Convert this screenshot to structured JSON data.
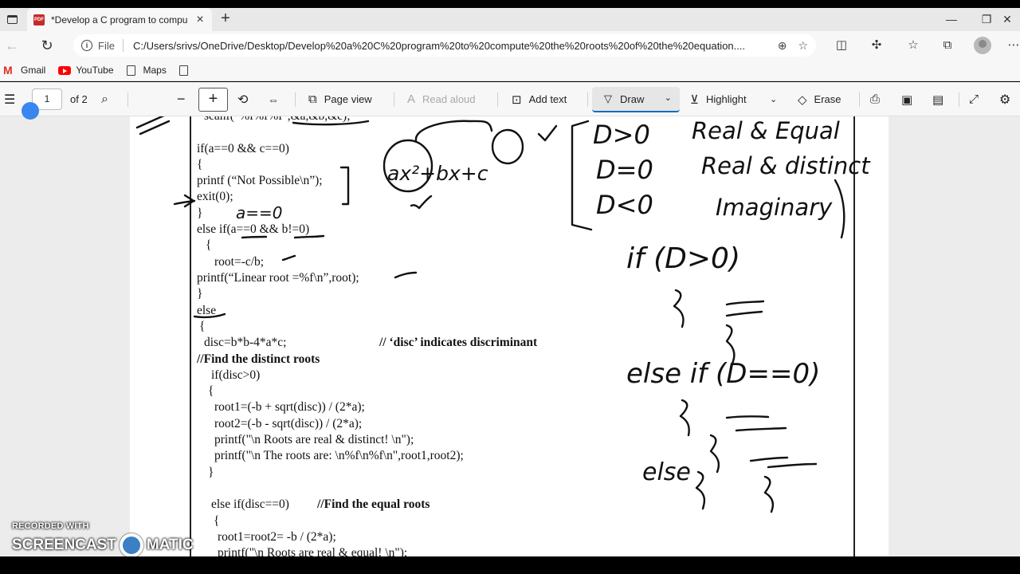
{
  "browser": {
    "tab_title": "*Develop a C program to compu",
    "url_scheme": "File",
    "url": "C:/Users/srivs/OneDrive/Desktop/Develop%20a%20C%20program%20to%20compute%20the%20roots%20of%20the%20equation....",
    "bookmarks": [
      {
        "label": "Gmail",
        "icon": "gmail-icon"
      },
      {
        "label": "YouTube",
        "icon": "youtube-icon"
      },
      {
        "label": "Maps",
        "icon": "page-icon"
      },
      {
        "label": "",
        "icon": "page-icon"
      }
    ]
  },
  "pdf_toolbar": {
    "page_number": "1",
    "page_total": "of 2",
    "page_view": "Page view",
    "read_aloud": "Read aloud",
    "add_text": "Add text",
    "draw": "Draw",
    "highlight": "Highlight",
    "erase": "Erase"
  },
  "document": {
    "lines": [
      {
        "text": "scanf(\"%f%f%f\",&a,&b,&c);"
      },
      {
        "text": "if(a==0 && c==0)"
      },
      {
        "text": "{"
      },
      {
        "text": "printf (“Not Possible\\n”);"
      },
      {
        "text": "exit(0);"
      },
      {
        "text": "}"
      },
      {
        "text": "else if(a==0 && b!=0)"
      },
      {
        "text": "{"
      },
      {
        "text": "root=-c/b;"
      },
      {
        "text": "printf(“Linear root =%f\\n”,root);"
      },
      {
        "text": "}"
      },
      {
        "text": "else"
      },
      {
        "text": "{"
      },
      {
        "text": "disc=b*b-4*a*c;"
      },
      {
        "text": "// ‘disc’ indicates discriminant"
      },
      {
        "text": "//Find the distinct roots"
      },
      {
        "text": "if(disc>0)"
      },
      {
        "text": "{"
      },
      {
        "text": "root1=(-b + sqrt(disc)) / (2*a);"
      },
      {
        "text": "root2=(-b - sqrt(disc)) / (2*a);"
      },
      {
        "text": "printf(\"\\n Roots are real & distinct! \\n\");"
      },
      {
        "text": "printf(\"\\n The roots are: \\n%f\\n%f\\n\",root1,root2);"
      },
      {
        "text": "}"
      },
      {
        "text": "else if(disc==0)"
      },
      {
        "text": "//Find the equal roots"
      },
      {
        "text": "{"
      },
      {
        "text": "root1=root2= -b / (2*a);"
      },
      {
        "text": "printf(\"\\n Roots are real & equal! \\n\");"
      }
    ]
  },
  "annotations": {
    "a_eq_0": "a==0",
    "poly": "ax²+bx+c",
    "d_gt": "D>0",
    "d_eq": "D=0",
    "d_lt": "D<0",
    "real_equal": "Real & Equal",
    "real_distinct": "Real & distinct",
    "imaginary": "Imaginary",
    "if_d": "if (D>0)",
    "else_if_d": "else if (D==0)",
    "else": "else"
  },
  "watermark": {
    "line1": "RECORDED WITH",
    "left": "SCREENCAST",
    "right": "MATIC"
  }
}
